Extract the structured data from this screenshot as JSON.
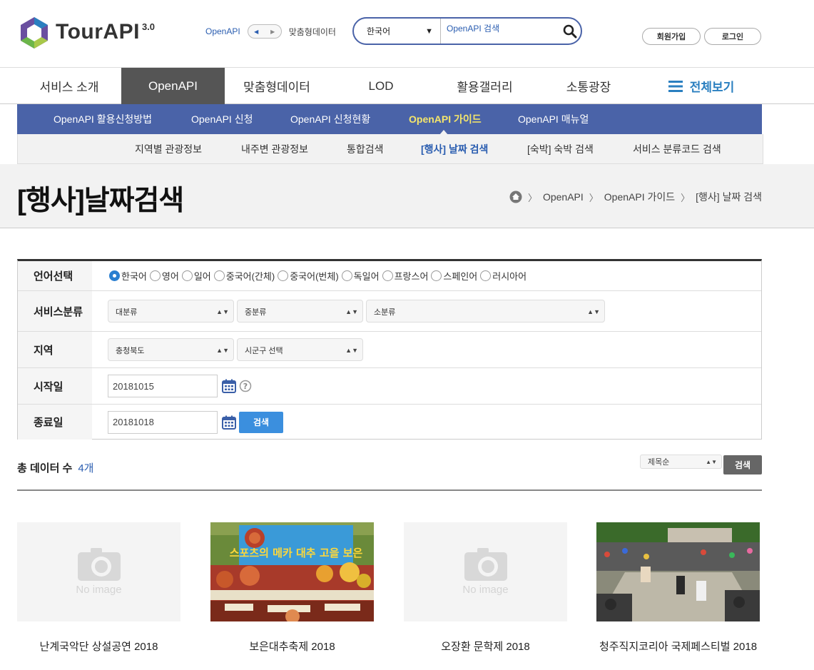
{
  "header": {
    "logo_text": "TourAPI",
    "logo_version": "3.0",
    "toggle_left": "OpenAPI",
    "toggle_right": "맞춤형데이터",
    "search_lang": "한국어",
    "search_placeholder": "OpenAPI 검색",
    "join_label": "회원가입",
    "login_label": "로그인"
  },
  "gnb": {
    "items": [
      "서비스 소개",
      "OpenAPI",
      "맞춤형데이터",
      "LOD",
      "활용갤러리",
      "소통광장"
    ],
    "all_label": "전체보기"
  },
  "snb": {
    "items": [
      "OpenAPI 활용신청방법",
      "OpenAPI 신청",
      "OpenAPI 신청현황",
      "OpenAPI 가이드",
      "OpenAPI 매뉴얼"
    ]
  },
  "tnb": {
    "items": [
      "지역별 관광정보",
      "내주변 관광정보",
      "통합검색",
      "[행사] 날짜 검색",
      "[숙박] 숙박 검색",
      "서비스 분류코드 검색"
    ]
  },
  "page": {
    "title": "[행사]날짜검색",
    "breadcrumb": [
      "OpenAPI",
      "OpenAPI 가이드",
      "[행사] 날짜 검색"
    ]
  },
  "form": {
    "lang_label": "언어선택",
    "languages": [
      "한국어",
      "영어",
      "일어",
      "중국어(간체)",
      "중국어(번체)",
      "독일어",
      "프랑스어",
      "스페인어",
      "러시아어"
    ],
    "selected_language": "한국어",
    "service_label": "서비스분류",
    "service_large": "대분류",
    "service_medium": "중분류",
    "service_small": "소분류",
    "region_label": "지역",
    "region_province": "충청북도",
    "region_city": "시군구 선택",
    "start_label": "시작일",
    "start_value": "20181015",
    "end_label": "종료일",
    "end_value": "20181018",
    "search_label": "검색"
  },
  "results": {
    "total_label": "총 데이터 수",
    "total_count": "4개",
    "sort_value": "제목순",
    "sort_button": "검색",
    "no_image": "No image",
    "cards": [
      {
        "title": "난계국악단 상설공연 2018",
        "has_image": false
      },
      {
        "title": "보은대추축제 2018",
        "has_image": true
      },
      {
        "title": "오장환 문학제 2018",
        "has_image": false
      },
      {
        "title": "청주직지코리아 국제페스티벌 2018",
        "has_image": true
      }
    ],
    "poster_text": "스포츠의 메카 대추 고을 보은"
  },
  "colors": {
    "brand_blue": "#4a63a8",
    "active_yellow": "#f5e66b",
    "link_blue": "#2a5db0",
    "search_button": "#3b8fde"
  }
}
